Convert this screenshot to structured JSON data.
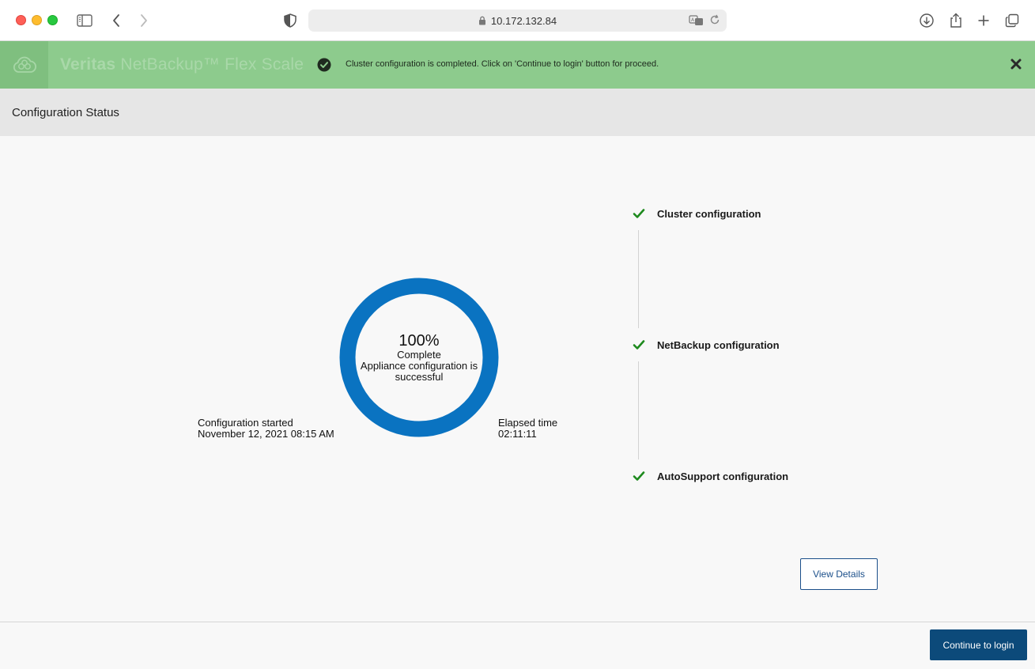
{
  "browser": {
    "url": "10.172.132.84",
    "icons": [
      "sidebar-icon",
      "back-icon",
      "forward-icon",
      "privacy-shield-icon",
      "lock-icon",
      "translate-icon",
      "reload-icon",
      "download-icon",
      "share-icon",
      "new-tab-icon",
      "tab-overview-icon"
    ]
  },
  "header": {
    "product_brand": "Veritas",
    "product_name": "NetBackup™ Flex Scale",
    "banner_message": "Cluster configuration is completed. Click on 'Continue to login' button for proceed.",
    "banner_color": "#8dcb8d"
  },
  "section": {
    "title": "Configuration Status"
  },
  "progress": {
    "percent": 100,
    "percent_label": "100%",
    "status_label": "Complete",
    "message": "Appliance configuration is successful",
    "ring_color": "#0a73c1"
  },
  "started": {
    "label": "Configuration started",
    "value": "November 12, 2021 08:15 AM"
  },
  "elapsed": {
    "label": "Elapsed time",
    "value": "02:11:11"
  },
  "steps": [
    {
      "label": "Cluster configuration",
      "status": "done"
    },
    {
      "label": "NetBackup configuration",
      "status": "done"
    },
    {
      "label": "AutoSupport configuration",
      "status": "done"
    }
  ],
  "check_color": "#1e8a1e",
  "buttons": {
    "view_details": "View Details",
    "continue": "Continue to login"
  }
}
